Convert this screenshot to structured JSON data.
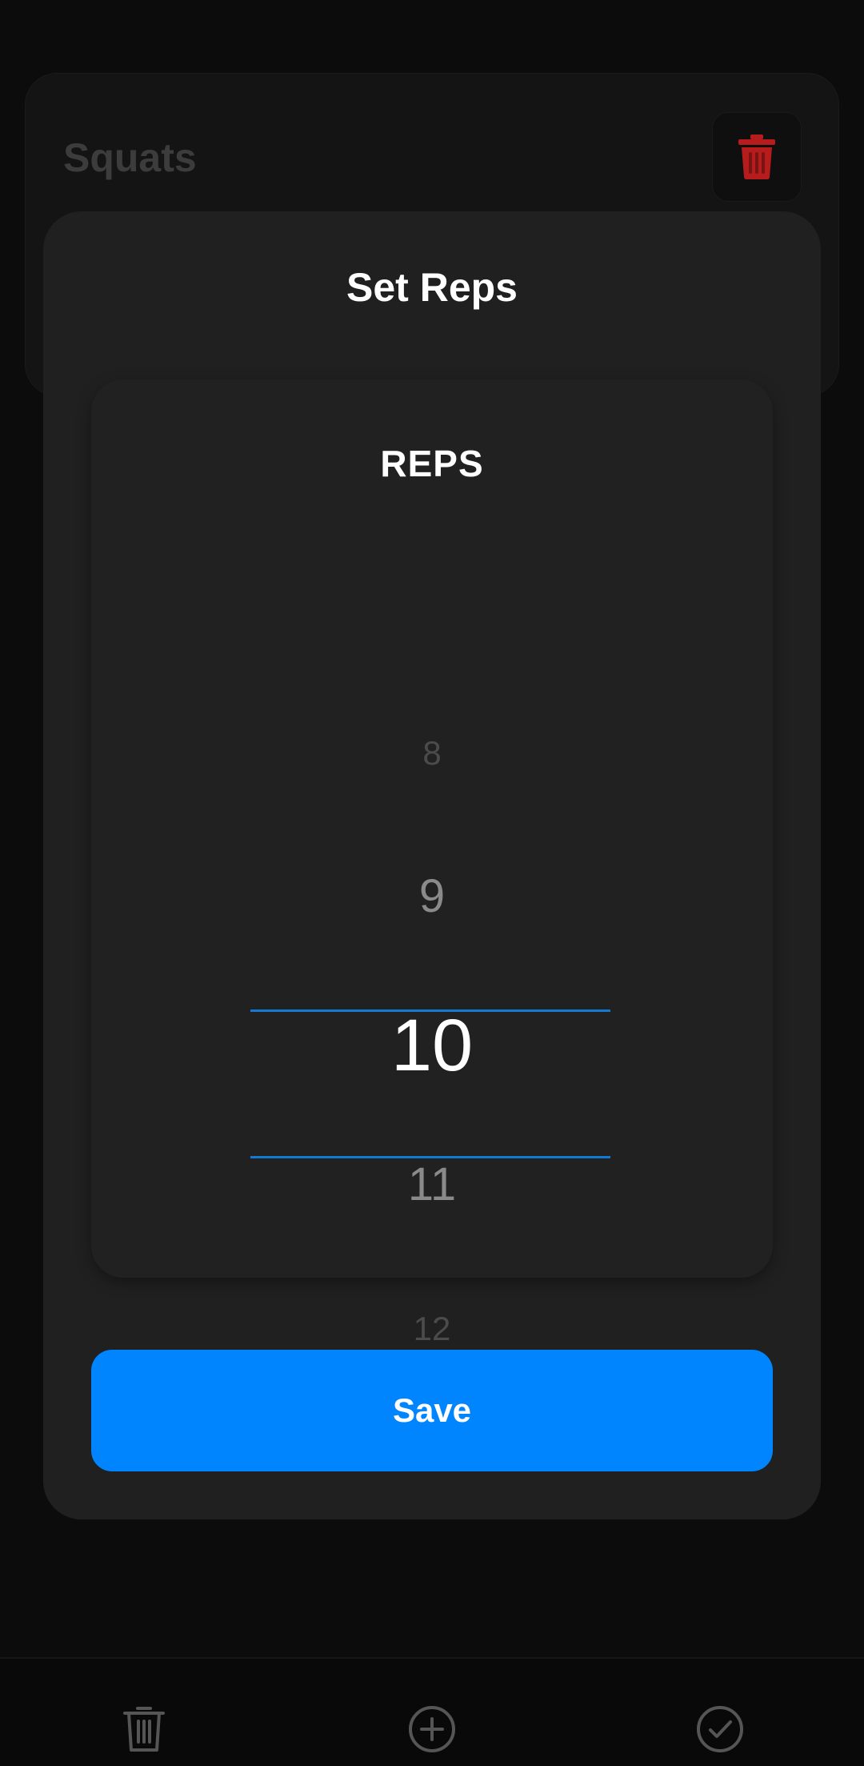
{
  "exercise": {
    "title": "Squats"
  },
  "modal": {
    "title": "Set Reps",
    "picker_label": "REPS",
    "values": [
      "8",
      "9",
      "10",
      "11",
      "12"
    ],
    "selected_value": "10",
    "save_label": "Save"
  },
  "colors": {
    "accent": "#0085ff",
    "divider": "#1479d1",
    "danger": "#b71c1c",
    "modal_bg": "#202020"
  },
  "icons": {
    "card_delete": "trash-icon",
    "bar_left": "trash-icon",
    "bar_center": "plus-circle-icon",
    "bar_right": "check-circle-icon"
  }
}
